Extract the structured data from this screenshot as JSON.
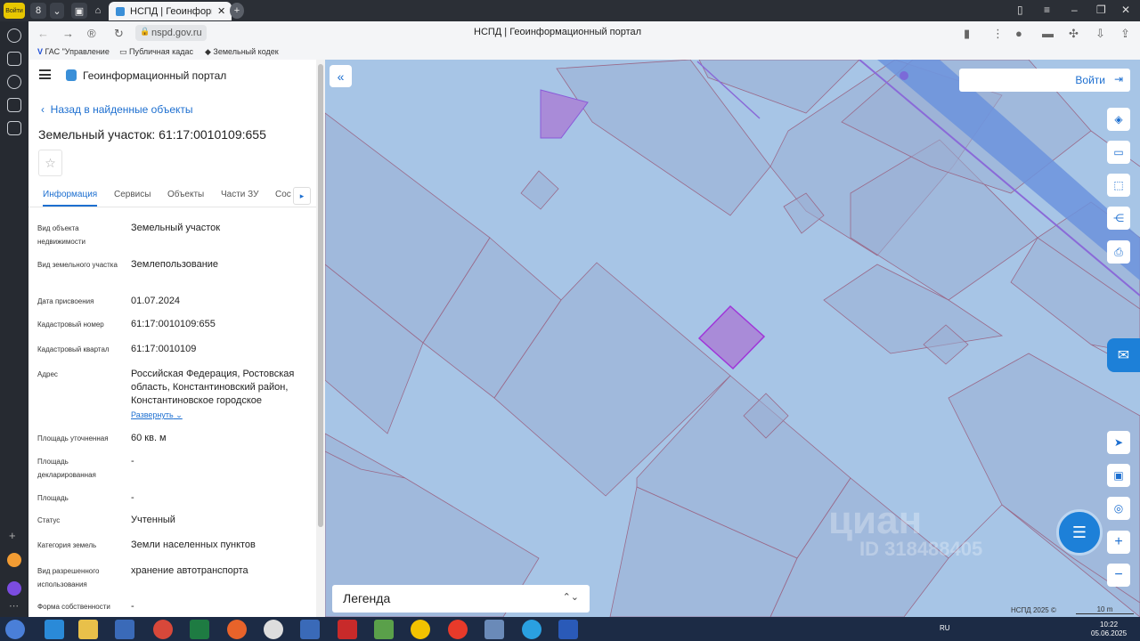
{
  "browser": {
    "tab_title": "НСПД | Геоинформационн",
    "tab_badge": "8",
    "url": "nspd.gov.ru",
    "page_title": "НСПД | Геоинформационный портал",
    "profile_label": "Войти"
  },
  "bookmarks": [
    {
      "label": "ГАС \"Управление"
    },
    {
      "label": "Публичная кадас"
    },
    {
      "label": "Земельный кодек"
    }
  ],
  "panel": {
    "portal_name": "Геоинформационный портал",
    "back_link": "Назад в найденные объекты",
    "title": "Земельный участок: 61:17:0010109:655",
    "tabs": [
      {
        "label": "Информация"
      },
      {
        "label": "Сервисы"
      },
      {
        "label": "Объекты"
      },
      {
        "label": "Части ЗУ"
      },
      {
        "label": "Состав"
      }
    ],
    "expand_label": "Развернуть",
    "rows": [
      {
        "label": "Вид объекта недвижимости",
        "value": "Земельный участок"
      },
      {
        "label": "Вид земельного участка",
        "value": "Землепользование"
      },
      {
        "label": "Дата присвоения",
        "value": "01.07.2024"
      },
      {
        "label": "Кадастровый номер",
        "value": "61:17:0010109:655"
      },
      {
        "label": "Кадастровый квартал",
        "value": "61:17:0010109"
      },
      {
        "label": "Адрес",
        "value": "Российская Федерация, Ростовская область, Константиновский район, Константиновское городское"
      },
      {
        "label": "Площадь уточненная",
        "value": "60 кв. м"
      },
      {
        "label": "Площадь декларированная",
        "value": "-"
      },
      {
        "label": "Площадь",
        "value": "-"
      },
      {
        "label": "Статус",
        "value": "Учтенный"
      },
      {
        "label": "Категория земель",
        "value": "Земли населенных пунктов"
      },
      {
        "label": "Вид разрешенного использования",
        "value": "хранение автотранспорта"
      },
      {
        "label": "Форма собственности",
        "value": "-"
      }
    ]
  },
  "map": {
    "login_label": "Войти",
    "legend_label": "Легенда",
    "watermark_text": "циан",
    "watermark_id": "ID 318488405",
    "copyright": "НСПД 2025 ©",
    "scale_label": "10 m",
    "colors": {
      "background": "#a7c5e6",
      "parcel": "#9aaed4",
      "selected": "#a98bd8",
      "road": "#6c93dd"
    }
  },
  "taskbar": {
    "lang": "RU",
    "time": "10:22",
    "date": "05.06.2025"
  }
}
